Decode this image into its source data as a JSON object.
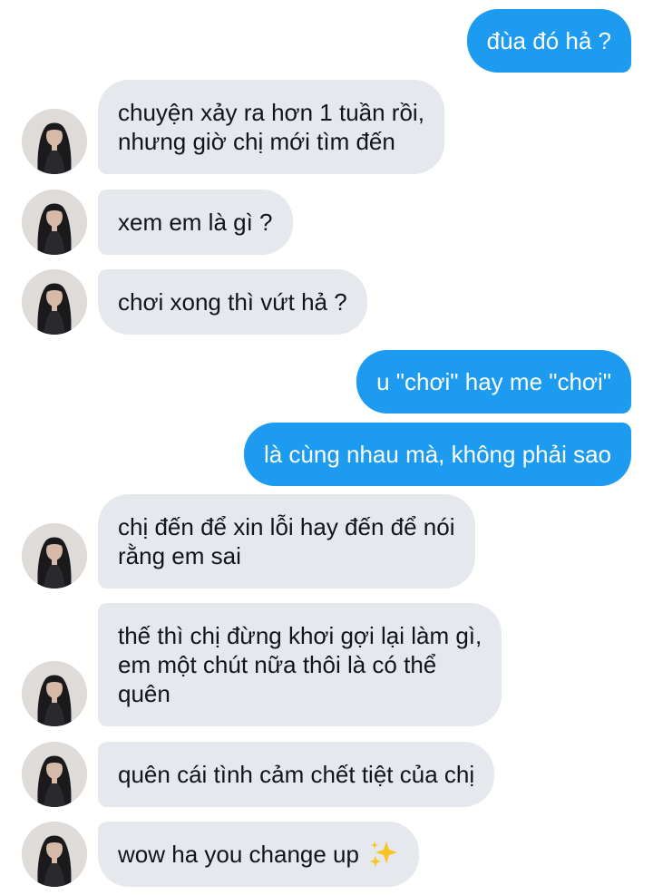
{
  "conversation": {
    "messages": [
      {
        "sender": "self",
        "text": "đùa đó hả ?"
      },
      {
        "sender": "other",
        "lines": [
          "chuyện xảy ra hơn 1 tuần rồi,",
          "nhưng giờ chị mới tìm đến"
        ]
      },
      {
        "sender": "other",
        "lines": [
          "xem em là gì ?"
        ]
      },
      {
        "sender": "other",
        "lines": [
          "chơi xong thì vứt hả ?"
        ]
      },
      {
        "sender": "self",
        "text": "u \"chơi\" hay me \"chơi\""
      },
      {
        "sender": "self",
        "text": "là cùng nhau mà, không phải sao"
      },
      {
        "sender": "other",
        "lines": [
          "chị đến để xin lỗi hay đến để nói",
          "rằng em sai"
        ]
      },
      {
        "sender": "other",
        "lines": [
          "thế thì chị đừng khơi gợi lại làm gì,",
          "em một chút nữa thôi là có thể",
          "quên"
        ]
      },
      {
        "sender": "other",
        "lines": [
          "quên cái tình cảm chết tiệt của chị"
        ]
      },
      {
        "sender": "other",
        "lines": [
          "wow ha you change up"
        ],
        "emoji": "✨"
      }
    ]
  },
  "colors": {
    "self_bubble": "#1d9bf0",
    "other_bubble": "#e5e9ee",
    "background": "#ffffff"
  },
  "icons": {
    "avatar": "contact-avatar-photo",
    "emoji": "sparkles-emoji"
  }
}
